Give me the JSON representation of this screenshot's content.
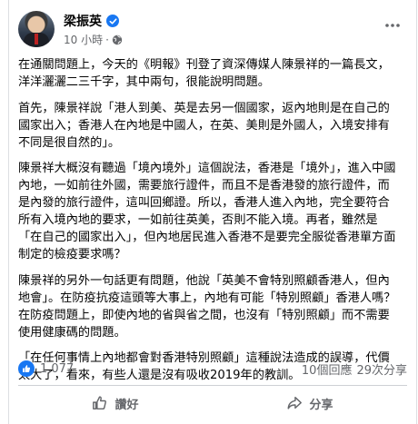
{
  "post": {
    "author": "梁振英",
    "timestamp": "10 小時",
    "separator": "·",
    "paragraphs": [
      "在通關問題上，今天的《明報》刊登了資深傳媒人陳景祥的一篇長文，洋洋灑灑二三千字，其中兩句，很能說明問題。",
      "首先，陳景祥說「港人到美、英是去另一個國家，返內地則是在自己的國家出入；香港人在內地是中國人，在英、美則是外國人，入境安排有不同是很自然的」。",
      "陳景祥大概沒有聽過「境內境外」這個說法，香港是「境外」，進入中國內地，一如前往外國，需要旅行證件，而且不是香港發的旅行證件，而是內發的旅行證件，這叫回鄉證。所以，香港人進入內地，完全要符合所有入境內地的要求，一如前往英美，否則不能入境。再者，雖然是「在自己的國家出入」，但內地居民進入香港不是要完全服從香港單方面制定的檢疫要求嗎？",
      "陳景祥的另外一句話更有問題，他說「英美不會特別照顧香港人，但內地會」。在防疫抗疫這頭等大事上，內地有可能「特別照顧」香港人嗎？在防疫問題上，即使內地的省與省之間，也沒有「特別照顧」而不需要使用健康碼的問題。",
      "「在任何事情上內地都會對香港特別照顧」這種說法造成的誤導，代價太大了，看來，有些人還是沒有吸收2019年的教訓。"
    ]
  },
  "stats": {
    "likes": "1,077",
    "comments": "10個回應",
    "shares": "29次分享"
  },
  "actions": {
    "like_label": "讚好",
    "share_label": "分享"
  },
  "colors": {
    "brand": "#1877f2",
    "secondary_text": "#65676b",
    "divider": "#ced0d4"
  },
  "icons": [
    "verified-icon",
    "globe-icon",
    "more-icon",
    "like-reaction-icon",
    "thumbs-up-icon",
    "share-icon"
  ]
}
